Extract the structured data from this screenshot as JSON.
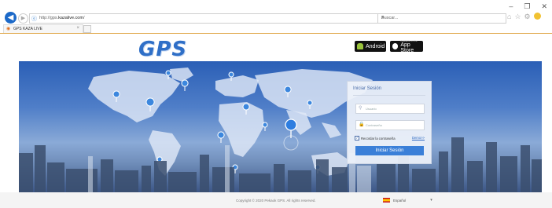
{
  "browser": {
    "url_prefix": "http://gps.",
    "url_domain": "kazalive.com",
    "url_suffix": "/",
    "search_placeholder": "Buscar...",
    "tab_title": "GPS KAZA LIVE",
    "window_controls": [
      "–",
      "❐",
      "✕"
    ]
  },
  "site": {
    "logo_text": "GPS",
    "android_label": "Android",
    "appstore_small": "Available on the",
    "appstore_label": "App Store"
  },
  "login": {
    "title": "Iniciar Sesión",
    "username_placeholder": "Usuario",
    "password_placeholder": "Contraseña",
    "remember_label": "Recordar la contraseña",
    "demo_link": "Demo>>",
    "submit_label": "Iniciar Sesión"
  },
  "footer": {
    "copyright": "Copyright © 2020 Pekaok GPS. All rights reserved.",
    "language": "Español"
  },
  "colors": {
    "accent": "#3a7fd8",
    "logo": "#2f6fc7",
    "browser_back": "#1c69c8"
  }
}
